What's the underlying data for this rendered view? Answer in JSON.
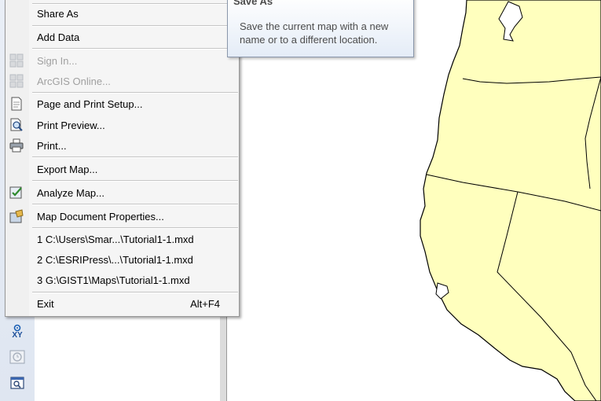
{
  "file_menu": {
    "items": [
      {
        "label": "Share As",
        "icon": "",
        "enabled": true
      },
      {
        "label": "Add Data",
        "icon": "",
        "enabled": true
      },
      {
        "label": "Sign In...",
        "icon": "grid-icon",
        "enabled": false
      },
      {
        "label": "ArcGIS Online...",
        "icon": "grid-icon",
        "enabled": false
      },
      {
        "label": "Page and Print Setup...",
        "icon": "page-setup-icon",
        "enabled": true
      },
      {
        "label": "Print Preview...",
        "icon": "print-preview-icon",
        "enabled": true
      },
      {
        "label": "Print...",
        "icon": "printer-icon",
        "enabled": true
      },
      {
        "label": "Export Map...",
        "icon": "",
        "enabled": true
      },
      {
        "label": "Analyze Map...",
        "icon": "analyze-icon",
        "enabled": true
      },
      {
        "label": "Map Document Properties...",
        "icon": "properties-icon",
        "enabled": true
      },
      {
        "label": "1 C:\\Users\\Smar...\\Tutorial1-1.mxd",
        "icon": "",
        "enabled": true
      },
      {
        "label": "2 C:\\ESRIPress\\...\\Tutorial1-1.mxd",
        "icon": "",
        "enabled": true
      },
      {
        "label": "3 G:\\GIST1\\Maps\\Tutorial1-1.mxd",
        "icon": "",
        "enabled": true
      },
      {
        "label": "Exit",
        "shortcut": "Alt+F4",
        "icon": "",
        "enabled": true
      }
    ]
  },
  "tooltip": {
    "title": "Save As",
    "body": "Save the current map with a new name or to a different location."
  },
  "toolbar": {
    "xy_label": "XY",
    "icons": [
      "go-to-xy-icon",
      "time-slider-icon",
      "zoom-window-icon"
    ]
  },
  "colors": {
    "map_land": "#ffffbe",
    "map_outline": "#000000",
    "menu_bg": "#f5f5f5",
    "tooltip_text": "#4c4c4c"
  }
}
